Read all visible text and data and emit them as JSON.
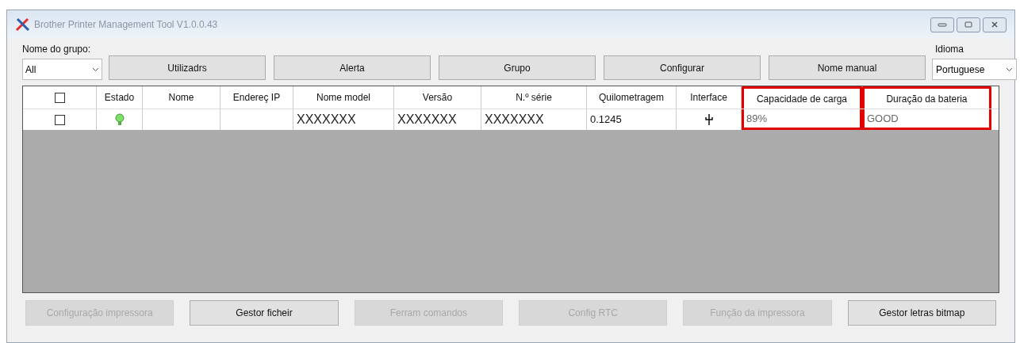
{
  "window": {
    "title": "Brother Printer Management Tool V1.0.0.43"
  },
  "group": {
    "label": "Nome do grupo:",
    "value": "All"
  },
  "top_buttons": [
    "Utilizadrs",
    "Alerta",
    "Grupo",
    "Configurar",
    "Nome manual"
  ],
  "language": {
    "label": "Idioma",
    "value": "Portuguese"
  },
  "table": {
    "header_checked": false,
    "columns": [
      {
        "label": "Estado",
        "highlighted": false
      },
      {
        "label": "Nome",
        "highlighted": false
      },
      {
        "label": "Endereç IP",
        "highlighted": false
      },
      {
        "label": "Nome model",
        "highlighted": false
      },
      {
        "label": "Versão",
        "highlighted": false
      },
      {
        "label": "N.º série",
        "highlighted": false
      },
      {
        "label": "Quilometragem",
        "highlighted": false
      },
      {
        "label": "Interface",
        "highlighted": false
      },
      {
        "label": "Capacidade de carga",
        "highlighted": true
      },
      {
        "label": "Duração da bateria",
        "highlighted": true
      }
    ],
    "rows": [
      {
        "checked": false,
        "cells": [
          {
            "kind": "status-light"
          },
          {
            "kind": "empty"
          },
          {
            "kind": "empty"
          },
          {
            "kind": "text",
            "text": "XXXXXXX"
          },
          {
            "kind": "text",
            "text": "XXXXXXX"
          },
          {
            "kind": "text",
            "text": "XXXXXXX"
          },
          {
            "kind": "text",
            "text": "0.1245"
          },
          {
            "kind": "usb"
          },
          {
            "kind": "text",
            "text": "89%"
          },
          {
            "kind": "text",
            "text": "GOOD"
          }
        ]
      }
    ]
  },
  "bottom_buttons": [
    {
      "label": "Configuração impressora",
      "disabled": true
    },
    {
      "label": "Gestor ficheir",
      "disabled": false
    },
    {
      "label": "Ferram comandos",
      "disabled": true
    },
    {
      "label": "Config RTC",
      "disabled": true
    },
    {
      "label": "Função da impressora",
      "disabled": true
    },
    {
      "label": "Gestor letras bitmap",
      "disabled": false
    }
  ]
}
